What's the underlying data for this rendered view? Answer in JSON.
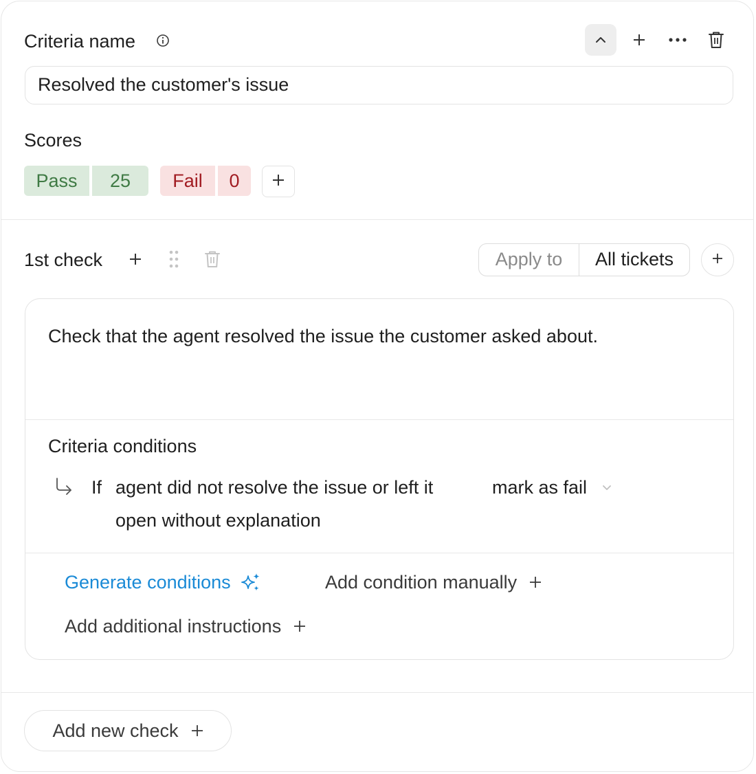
{
  "criteria": {
    "name_label": "Criteria name",
    "name_value": "Resolved the customer's issue",
    "scores_label": "Scores",
    "scores": [
      {
        "label": "Pass",
        "value": "25"
      },
      {
        "label": "Fail",
        "value": "0"
      }
    ]
  },
  "check": {
    "title": "1st check",
    "apply_to_label": "Apply to",
    "apply_to_value": "All tickets",
    "description": "Check that the agent resolved the issue the customer asked about.",
    "conditions_label": "Criteria conditions",
    "condition": {
      "if_label": "If",
      "text_line1": "agent did not resolve the issue or left it",
      "text_line2": "open without explanation",
      "action": "mark as fail"
    },
    "generate_label": "Generate conditions",
    "add_manual_label": "Add condition manually",
    "add_instructions_label": "Add additional instructions"
  },
  "footer": {
    "add_check_label": "Add new check"
  },
  "icons": {
    "info": "info-icon",
    "collapse": "chevron-up-icon",
    "add": "plus-icon",
    "more": "more-horizontal-icon",
    "delete": "trash-icon",
    "drag": "drag-handle-icon",
    "sparkle": "sparkle-icon",
    "dropdown": "chevron-down-icon",
    "branch": "return-arrow-icon"
  },
  "colors": {
    "pass_bg": "#dbeadc",
    "pass_text": "#3f7a44",
    "fail_bg": "#f9e1e1",
    "fail_text": "#a11c22",
    "link_blue": "#1a8ad6"
  }
}
